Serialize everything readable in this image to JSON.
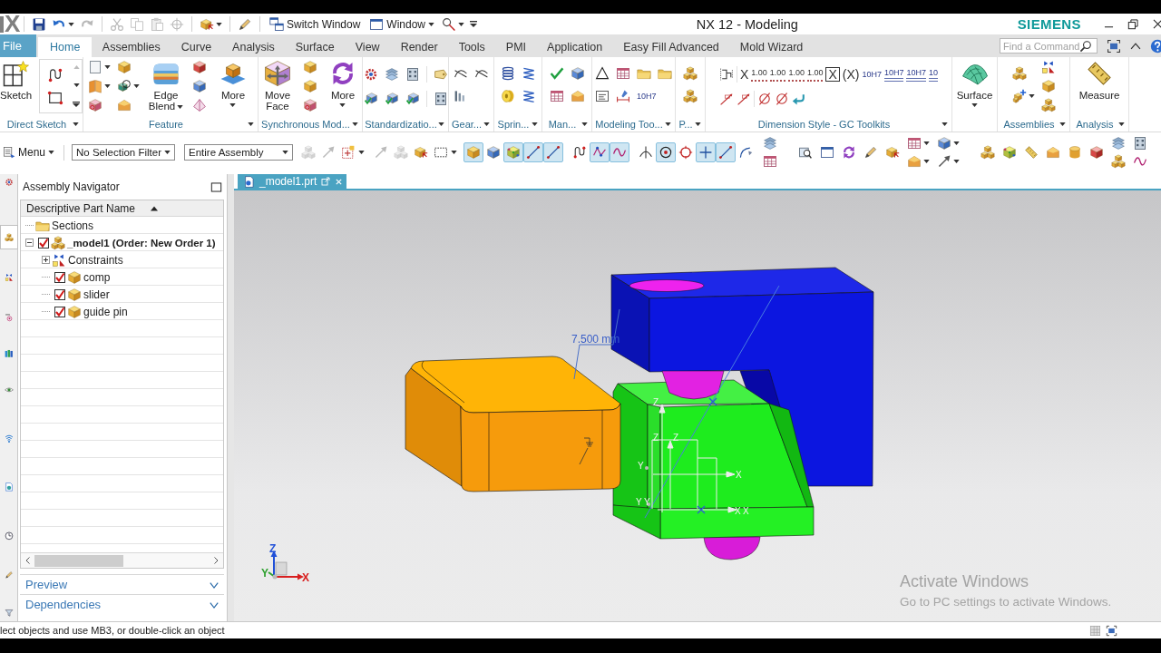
{
  "title_bar": {
    "logo": "X",
    "quick_access": [
      {
        "label": "Switch Window",
        "menu": false
      },
      {
        "label": "Window",
        "menu": true
      }
    ],
    "title": "NX 12 - Modeling",
    "brand": "SIEMENS"
  },
  "ribbon": {
    "file": "File",
    "tabs": [
      {
        "label": "Home",
        "selected": true
      },
      {
        "label": "Assemblies",
        "selected": false
      },
      {
        "label": "Curve",
        "selected": false
      },
      {
        "label": "Analysis",
        "selected": false
      },
      {
        "label": "Surface",
        "selected": false
      },
      {
        "label": "View",
        "selected": false
      },
      {
        "label": "Render",
        "selected": false
      },
      {
        "label": "Tools",
        "selected": false
      },
      {
        "label": "PMI",
        "selected": false
      },
      {
        "label": "Application",
        "selected": false
      },
      {
        "label": "Easy Fill Advanced",
        "selected": false
      },
      {
        "label": "Mold Wizard",
        "selected": false
      }
    ],
    "search": {
      "placeholder": "Find a Command"
    },
    "groups": [
      {
        "label": "Direct Sketch",
        "menu": true,
        "buttons": [
          {
            "label": "Sketch",
            "menu": false
          }
        ]
      },
      {
        "label": "Feature",
        "menu": true,
        "buttons": [
          {
            "label": "Edge Blend",
            "menu": true
          },
          {
            "label": "More",
            "menu": true
          }
        ]
      },
      {
        "label": "Synchronous Mod...",
        "menu": true,
        "buttons": [
          {
            "label": "Move Face",
            "menu": false
          },
          {
            "label": "More",
            "menu": true
          }
        ]
      },
      {
        "label": "Standardizatio...",
        "menu": true
      },
      {
        "label": "Gear...",
        "menu": true
      },
      {
        "label": "Sprin...",
        "menu": true
      },
      {
        "label": "Man...",
        "menu": true
      },
      {
        "label": "Modeling Too...",
        "menu": true,
        "symbols": [
          {
            "text": "10H7",
            "kind": "code"
          }
        ]
      },
      {
        "label": "P...",
        "menu": true
      },
      {
        "label": "Dimension Style - GC Toolkits",
        "menu": true,
        "symbols": [
          {
            "text": "X",
            "kind": "plain"
          },
          {
            "text": "1.00",
            "kind": "tolerance"
          },
          {
            "text": "1.00",
            "kind": "tolerance"
          },
          {
            "text": "1.00",
            "kind": "tolerance"
          },
          {
            "text": "1.00",
            "kind": "tolerance"
          },
          {
            "text": "X",
            "kind": "boxed"
          },
          {
            "text": "(X)",
            "kind": "plain"
          },
          {
            "text": "10H7",
            "kind": "code"
          },
          {
            "text": "10H7",
            "kind": "fit"
          },
          {
            "text": "10H7",
            "kind": "fit"
          },
          {
            "text": "10",
            "kind": "fit"
          }
        ]
      },
      {
        "menu": false,
        "buttons": [
          {
            "label": "Surface",
            "menu": true
          }
        ]
      },
      {
        "label": "Assemblies",
        "menu": true
      },
      {
        "label": "Analysis",
        "menu": true,
        "buttons": [
          {
            "label": "Measure",
            "menu": false
          }
        ]
      }
    ]
  },
  "toolbar": {
    "menu": "Menu",
    "selection_filter": "No Selection Filter",
    "scope": "Entire Assembly",
    "tools": [
      {
        "on": false,
        "disabled": true
      },
      {
        "on": false,
        "disabled": true
      },
      {
        "on": false,
        "disabled": false
      },
      {
        "on": false,
        "disabled": true
      },
      {
        "on": false,
        "disabled": true
      },
      {
        "on": false,
        "disabled": false
      },
      {
        "on": false,
        "disabled": false
      },
      {
        "on": true,
        "disabled": false
      },
      {
        "on": false,
        "disabled": false
      },
      {
        "on": true,
        "disabled": false
      },
      {
        "on": true,
        "disabled": false
      },
      {
        "on": true,
        "disabled": false
      },
      {
        "on": false,
        "disabled": false
      },
      {
        "on": true,
        "disabled": false
      },
      {
        "on": true,
        "disabled": false
      },
      {
        "on": false,
        "disabled": false
      },
      {
        "on": true,
        "disabled": false
      },
      {
        "on": false,
        "disabled": false
      },
      {
        "on": true,
        "disabled": false
      },
      {
        "on": true,
        "disabled": false
      },
      {
        "on": false,
        "disabled": false
      }
    ]
  },
  "resource_bar": [
    {
      "selected": false
    },
    {
      "selected": true
    },
    {
      "selected": false
    },
    {
      "selected": false
    },
    {
      "selected": false
    },
    {
      "selected": false
    },
    {
      "selected": false
    },
    {
      "selected": false
    },
    {
      "selected": false
    },
    {
      "selected": false
    },
    {
      "selected": false
    }
  ],
  "navigator": {
    "title": "Assembly Navigator",
    "column": "Descriptive Part Name",
    "tree": [
      {
        "label": "Sections",
        "kind": "folder"
      },
      {
        "label": "_model1 (Order: New Order 1)",
        "kind": "assembly",
        "checked": true,
        "expanded": true,
        "children": [
          {
            "label": "Constraints",
            "kind": "constraints",
            "expanded": false
          },
          {
            "label": "comp",
            "kind": "part",
            "checked": true
          },
          {
            "label": "slider",
            "kind": "part",
            "checked": true
          },
          {
            "label": "guide pin",
            "kind": "part",
            "checked": true
          }
        ]
      }
    ],
    "panels": [
      {
        "label": "Preview",
        "expanded": false
      },
      {
        "label": "Dependencies",
        "expanded": false
      }
    ]
  },
  "document_tabs": [
    {
      "label": "_model1.prt",
      "selected": true
    }
  ],
  "viewport": {
    "dimension": "7.500 mm",
    "csys_labels": [
      "Z",
      "Z",
      "Z",
      "Y",
      "Y",
      "Y",
      "X",
      "X",
      "X"
    ],
    "triad": [
      {
        "text": "Z",
        "color": "#2050d8"
      },
      {
        "text": "Y",
        "color": "#2fa02f"
      },
      {
        "text": "X",
        "color": "#d82020"
      }
    ]
  },
  "os_notice": {
    "title": "Activate Windows",
    "text": "Go to PC settings to activate Windows."
  },
  "status_bar": {
    "message": "lect objects and use MB3, or double-click an object"
  }
}
